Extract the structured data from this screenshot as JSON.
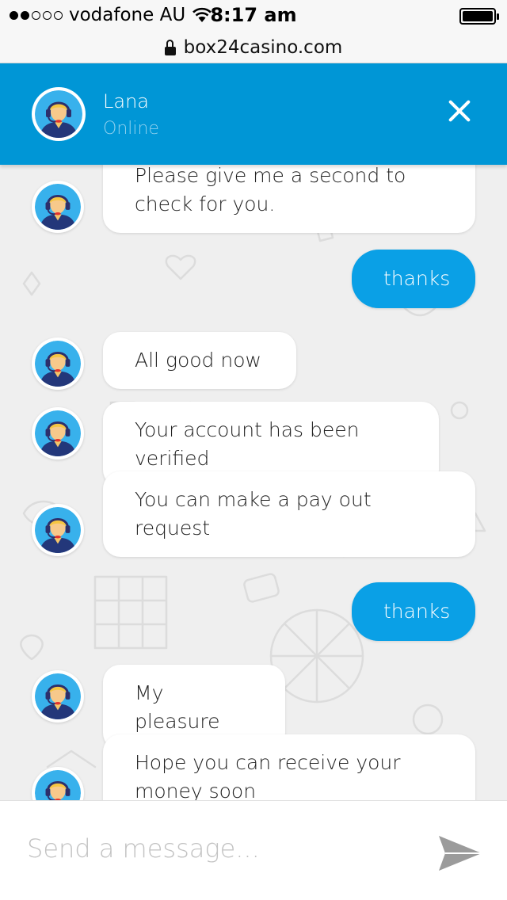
{
  "status_bar": {
    "carrier": "vodafone AU",
    "time": "8:17 am",
    "signal_bars_filled": 2,
    "signal_bars_total": 5,
    "battery_level": 1.0
  },
  "browser": {
    "url": "box24casino.com"
  },
  "chat_header": {
    "agent_name": "Lana",
    "agent_status": "Online"
  },
  "messages": [
    {
      "sender": "agent",
      "text": "Please give me a second to check for you."
    },
    {
      "sender": "user",
      "text": "thanks"
    },
    {
      "sender": "agent",
      "text": "All good now"
    },
    {
      "sender": "agent",
      "text": "Your account has been verified"
    },
    {
      "sender": "agent",
      "text": "You can make a pay out request"
    },
    {
      "sender": "user",
      "text": "thanks"
    },
    {
      "sender": "agent",
      "text": "My pleasure"
    },
    {
      "sender": "agent",
      "text": "Hope you can receive your money soon"
    }
  ],
  "composer": {
    "placeholder": "Send a message..."
  },
  "colors": {
    "header_blue": "#0096d6",
    "user_bubble": "#0aa0e6",
    "agent_bubble": "#ffffff",
    "status_online": "#8fd0ee"
  }
}
